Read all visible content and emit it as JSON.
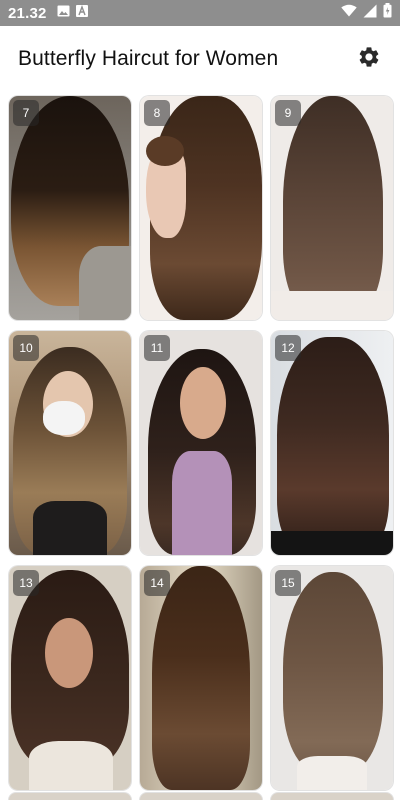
{
  "status_bar": {
    "time": "21.32",
    "left_icons": [
      "image-icon",
      "text-a-icon"
    ],
    "right_icons": [
      "wifi-icon",
      "signal-icon",
      "battery-icon"
    ]
  },
  "app_bar": {
    "title": "Butterfly Haircut for Women",
    "settings_icon": "gear-icon"
  },
  "gallery": {
    "items": [
      {
        "number": "7"
      },
      {
        "number": "8"
      },
      {
        "number": "9"
      },
      {
        "number": "10"
      },
      {
        "number": "11"
      },
      {
        "number": "12"
      },
      {
        "number": "13"
      },
      {
        "number": "14"
      },
      {
        "number": "15"
      }
    ]
  },
  "colors": {
    "status_bar": "#8e8e8e",
    "badge": "#282828",
    "title_text": "#111111"
  }
}
